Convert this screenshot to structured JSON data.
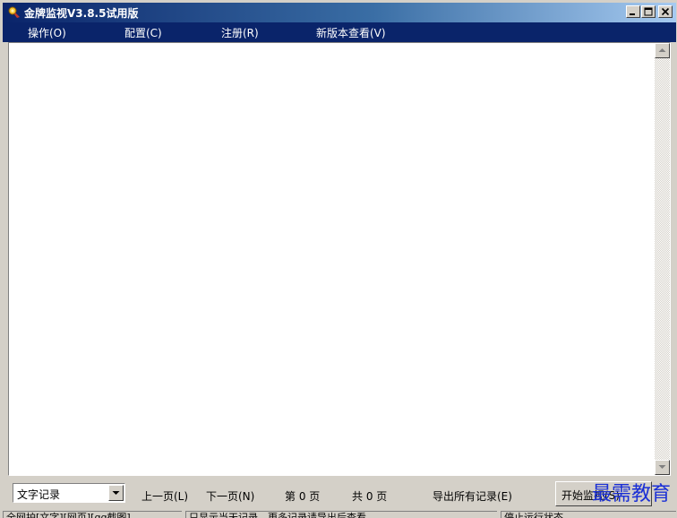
{
  "window": {
    "title": "金牌监视V3.8.5试用版"
  },
  "menu": {
    "items": [
      {
        "label": "操作(O)"
      },
      {
        "label": "配置(C)"
      },
      {
        "label": "注册(R)"
      },
      {
        "label": "新版本查看(V)"
      }
    ]
  },
  "toolbar": {
    "record_type": "文字记录",
    "prev_page": "上一页(L)",
    "next_page": "下一页(N)",
    "page_label": "第 0 页",
    "total_label": "共 0 页",
    "export_all": "导出所有记录(E)",
    "start_button": "开始监视(S)"
  },
  "watermark": "最需教育",
  "status": {
    "pane1": "全网护[文字][网页][qq截图]",
    "pane2": "只显示当天记录，更多记录请导出后查看",
    "pane3": "停止运行状态"
  },
  "icons": {
    "app": "gold-medal-icon",
    "minimize": "minimize-icon",
    "maximize": "maximize-icon",
    "close": "close-icon"
  },
  "colors": {
    "title_start": "#0a246a",
    "title_end": "#a6caf0",
    "menubar": "#0a246a",
    "face": "#d4d0c8",
    "watermark": "#1a2fd6"
  }
}
